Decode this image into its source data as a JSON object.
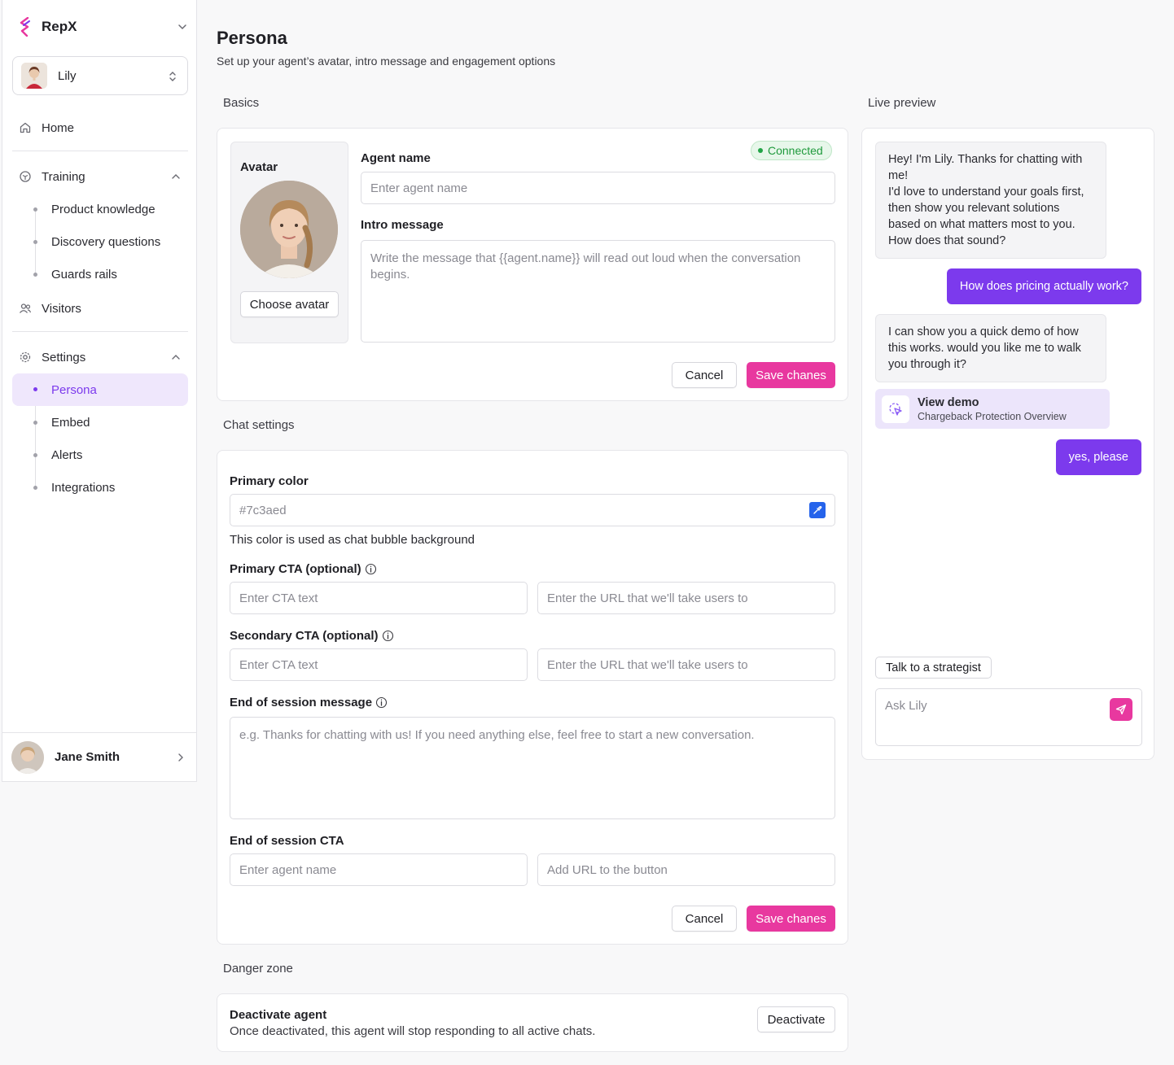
{
  "sidebar": {
    "brand": "RepX",
    "agent_selector": "Lily",
    "nav": {
      "home": "Home",
      "training": "Training",
      "training_items": [
        "Product knowledge",
        "Discovery questions",
        "Guards rails"
      ],
      "visitors": "Visitors",
      "settings": "Settings",
      "settings_items": [
        "Persona",
        "Embed",
        "Alerts",
        "Integrations"
      ]
    },
    "active_item": "Persona",
    "user": "Jane Smith"
  },
  "header": {
    "title": "Persona",
    "subtitle": "Set up your agent’s avatar, intro message and engagement options"
  },
  "basics": {
    "section": "Basics",
    "avatar_label": "Avatar",
    "choose_avatar": "Choose avatar",
    "status": "Connected",
    "agent_name_label": "Agent name",
    "agent_name_placeholder": "Enter agent name",
    "intro_label": "Intro message",
    "intro_placeholder": "Write the message that {{agent.name}} will read out loud when the conversation begins.",
    "cancel": "Cancel",
    "save": "Save chanes"
  },
  "chat_settings": {
    "section": "Chat settings",
    "primary_color_label": "Primary color",
    "primary_color_value": "#7c3aed",
    "primary_color_help": "This color is used as chat bubble background",
    "primary_cta_label": "Primary CTA (optional)",
    "secondary_cta_label": "Secondary CTA (optional)",
    "cta_text_placeholder": "Enter CTA text",
    "cta_url_placeholder": "Enter the URL that we'll take users to",
    "end_message_label": "End of session message",
    "end_message_placeholder": "e.g. Thanks for chatting with us! If you need anything else, feel free to start a new conversation.",
    "end_cta_label": "End of session CTA",
    "end_cta_text_placeholder": "Enter agent name",
    "end_cta_url_placeholder": "Add URL to the button",
    "cancel": "Cancel",
    "save": "Save chanes"
  },
  "danger": {
    "section": "Danger zone",
    "title": "Deactivate agent",
    "description": "Once deactivated, this agent will stop responding to all active chats.",
    "button": "Deactivate"
  },
  "preview": {
    "section": "Live preview",
    "messages": {
      "bot1": "Hey! I'm Lily. Thanks for chatting with me!\nI'd love to understand your goals first, then show you relevant solutions based on what matters most to you. How does that sound?",
      "user1": "How does pricing actually work?",
      "bot2": "I can show you a quick demo of how this works. would you like me to walk you through it?",
      "user2": "yes, please"
    },
    "demo_title": "View demo",
    "demo_subtitle": "Chargeback Protection Overview",
    "quick_reply": "Talk to a strategist",
    "input_placeholder": "Ask Lily"
  },
  "colors": {
    "accent": "#7c3aed",
    "brand_pink": "#e8389f",
    "success": "#22a447"
  },
  "icons": {
    "brand": "repx-logo-icon",
    "home": "home-icon",
    "training": "training-icon",
    "visitors": "visitors-icon",
    "settings": "gear-icon",
    "send": "send-icon",
    "demo": "cursor-click-icon",
    "eyedropper": "eyedropper-icon",
    "info": "info-icon"
  }
}
